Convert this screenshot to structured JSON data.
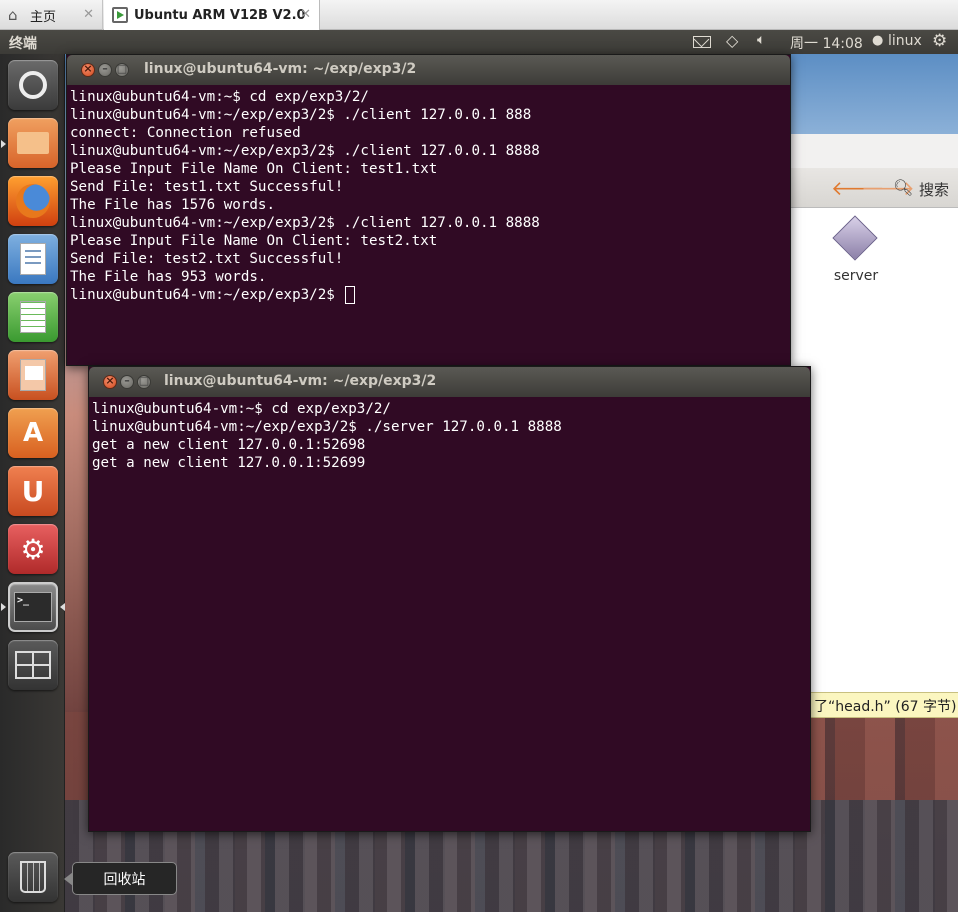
{
  "vm_tabs": {
    "home_label": "主页",
    "vm_label": "Ubuntu ARM V12B V2.0"
  },
  "top_panel": {
    "app_title": "终端",
    "clock": "周一 14:08",
    "user": "linux"
  },
  "launcher": {
    "trash_tooltip": "回收站"
  },
  "file_manager": {
    "search_label": "搜索",
    "file_name": "server",
    "status_text": "了“head.h” (67 字节)"
  },
  "terminal_client": {
    "title": "linux@ubuntu64-vm: ~/exp/exp3/2",
    "lines": [
      "linux@ubuntu64-vm:~$ cd exp/exp3/2/",
      "linux@ubuntu64-vm:~/exp/exp3/2$ ./client 127.0.0.1 888",
      "connect: Connection refused",
      "linux@ubuntu64-vm:~/exp/exp3/2$ ./client 127.0.0.1 8888",
      "Please Input File Name On Client: test1.txt",
      "Send File: test1.txt Successful!",
      "The File has 1576 words.",
      "linux@ubuntu64-vm:~/exp/exp3/2$ ./client 127.0.0.1 8888",
      "Please Input File Name On Client: test2.txt",
      "Send File: test2.txt Successful!",
      "The File has 953 words.",
      "linux@ubuntu64-vm:~/exp/exp3/2$ "
    ]
  },
  "terminal_server": {
    "title": "linux@ubuntu64-vm: ~/exp/exp3/2",
    "lines": [
      "linux@ubuntu64-vm:~$ cd exp/exp3/2/",
      "linux@ubuntu64-vm:~/exp/exp3/2$ ./server 127.0.0.1 8888",
      "get a new client 127.0.0.1:52698",
      "get a new client 127.0.0.1:52699"
    ]
  }
}
